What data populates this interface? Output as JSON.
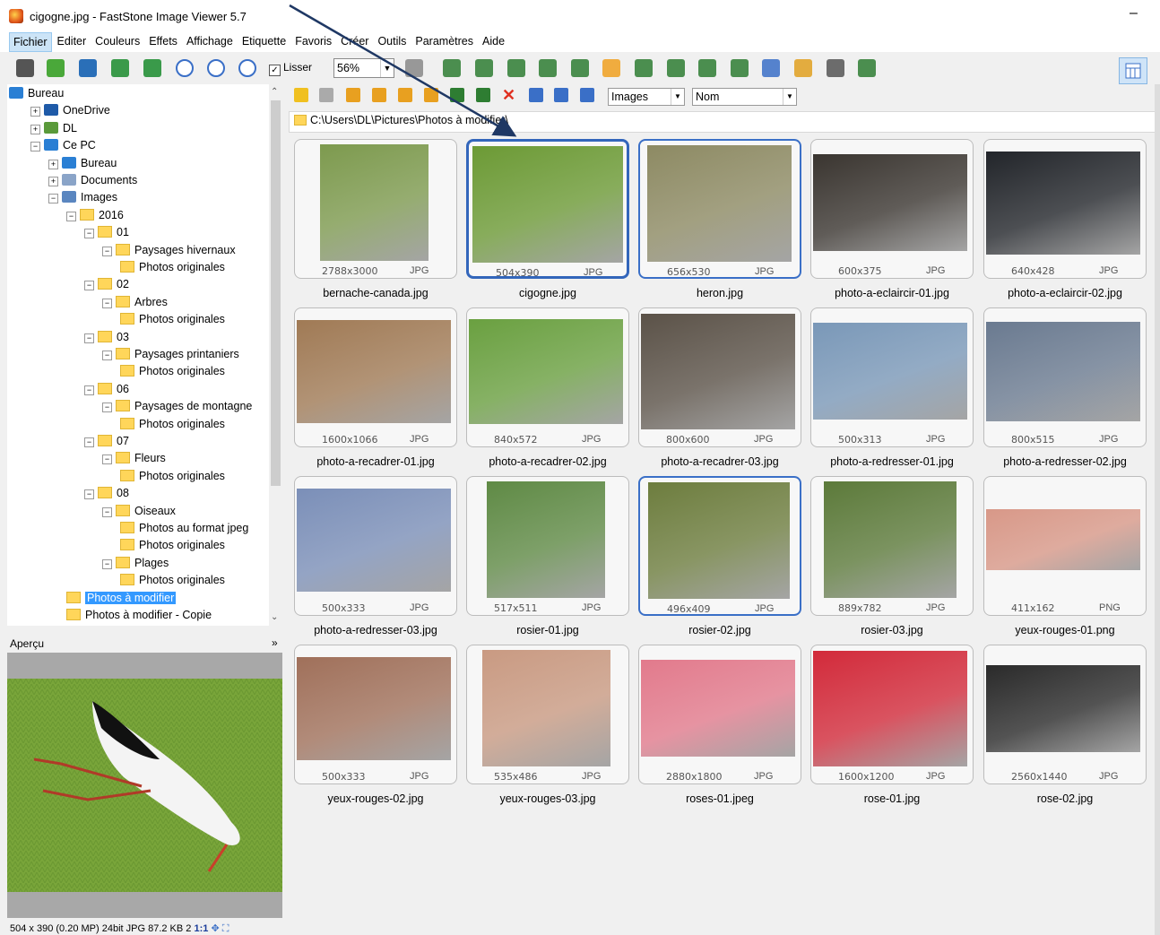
{
  "window": {
    "title": "cigogne.jpg  -  FastStone Image Viewer 5.7",
    "minimize": "–"
  },
  "menu": [
    "Fichier",
    "Editer",
    "Couleurs",
    "Effets",
    "Affichage",
    "Etiquette",
    "Favoris",
    "Créer",
    "Outils",
    "Paramètres",
    "Aide"
  ],
  "toolbar": {
    "smooth_label": "Lisser",
    "smooth_checked": "✓",
    "zoom": "56%"
  },
  "nav": {
    "filter": "Images",
    "sort": "Nom",
    "path": "C:\\Users\\DL\\Pictures\\Photos à modifier\\"
  },
  "tree": [
    {
      "label": "Bureau",
      "icon": "desktop-icon"
    },
    {
      "label": "OneDrive",
      "icon": "cloud-icon",
      "pm": "+"
    },
    {
      "label": "DL",
      "icon": "user-icon",
      "pm": "+"
    },
    {
      "label": "Ce PC",
      "icon": "computer-icon",
      "pm": "−"
    },
    {
      "label": "Bureau",
      "icon": "desktop-icon",
      "pm": "+"
    },
    {
      "label": "Documents",
      "icon": "document-icon",
      "pm": "+"
    },
    {
      "label": "Images",
      "icon": "pictures-icon",
      "pm": "−"
    },
    {
      "label": "2016",
      "icon": "folder-icon",
      "pm": "−"
    },
    {
      "label": "01",
      "icon": "folder-icon",
      "pm": "−"
    },
    {
      "label": "Paysages hivernaux",
      "icon": "folder-icon",
      "pm": "−"
    },
    {
      "label": "Photos originales",
      "icon": "folder-icon"
    },
    {
      "label": "02",
      "icon": "folder-icon",
      "pm": "−"
    },
    {
      "label": "Arbres",
      "icon": "folder-icon",
      "pm": "−"
    },
    {
      "label": "Photos originales",
      "icon": "folder-icon"
    },
    {
      "label": "03",
      "icon": "folder-icon",
      "pm": "−"
    },
    {
      "label": "Paysages printaniers",
      "icon": "folder-icon",
      "pm": "−"
    },
    {
      "label": "Photos originales",
      "icon": "folder-icon"
    },
    {
      "label": "06",
      "icon": "folder-icon",
      "pm": "−"
    },
    {
      "label": "Paysages de montagne",
      "icon": "folder-icon",
      "pm": "−"
    },
    {
      "label": "Photos originales",
      "icon": "folder-icon"
    },
    {
      "label": "07",
      "icon": "folder-icon",
      "pm": "−"
    },
    {
      "label": "Fleurs",
      "icon": "folder-icon",
      "pm": "−"
    },
    {
      "label": "Photos originales",
      "icon": "folder-icon"
    },
    {
      "label": "08",
      "icon": "folder-icon",
      "pm": "−"
    },
    {
      "label": "Oiseaux",
      "icon": "folder-icon",
      "pm": "−"
    },
    {
      "label": "Photos au format jpeg",
      "icon": "folder-icon"
    },
    {
      "label": "Photos originales",
      "icon": "folder-icon"
    },
    {
      "label": "Plages",
      "icon": "folder-icon",
      "pm": "−"
    },
    {
      "label": "Photos originales",
      "icon": "folder-icon"
    },
    {
      "label": "Photos à modifier",
      "icon": "folder-icon",
      "selected": true
    },
    {
      "label": "Photos à modifier - Copie",
      "icon": "folder-icon"
    }
  ],
  "preview": {
    "label": "Aperçu",
    "toggle": "»",
    "status": "504 x 390 (0.20 MP)  24bit  JPG  87.2 KB  2",
    "ratio": "1:1"
  },
  "thumbnails": [
    {
      "name": "bernache-canada.jpg",
      "dims": "2788x3000",
      "ext": "JPG",
      "color": "#7d9a4e"
    },
    {
      "name": "cigogne.jpg",
      "dims": "504x390",
      "ext": "JPG",
      "color": "#6c9a35",
      "selected": true
    },
    {
      "name": "heron.jpg",
      "dims": "656x530",
      "ext": "JPG",
      "color": "#8d8a63",
      "hover": true
    },
    {
      "name": "photo-a-eclaircir-01.jpg",
      "dims": "600x375",
      "ext": "JPG",
      "color": "#3a3530"
    },
    {
      "name": "photo-a-eclaircir-02.jpg",
      "dims": "640x428",
      "ext": "JPG",
      "color": "#22252a"
    },
    {
      "name": "photo-a-recadrer-01.jpg",
      "dims": "1600x1066",
      "ext": "JPG",
      "color": "#a07a55"
    },
    {
      "name": "photo-a-recadrer-02.jpg",
      "dims": "840x572",
      "ext": "JPG",
      "color": "#6aa040"
    },
    {
      "name": "photo-a-recadrer-03.jpg",
      "dims": "800x600",
      "ext": "JPG",
      "color": "#5b5248"
    },
    {
      "name": "photo-a-redresser-01.jpg",
      "dims": "500x313",
      "ext": "JPG",
      "color": "#7a98b8"
    },
    {
      "name": "photo-a-redresser-02.jpg",
      "dims": "800x515",
      "ext": "JPG",
      "color": "#6a7a90"
    },
    {
      "name": "photo-a-redresser-03.jpg",
      "dims": "500x333",
      "ext": "JPG",
      "color": "#7b8fb8"
    },
    {
      "name": "rosier-01.jpg",
      "dims": "517x511",
      "ext": "JPG",
      "color": "#5f8a45"
    },
    {
      "name": "rosier-02.jpg",
      "dims": "496x409",
      "ext": "JPG",
      "color": "#6d7d3e",
      "hover": true
    },
    {
      "name": "rosier-03.jpg",
      "dims": "889x782",
      "ext": "JPG",
      "color": "#5c7a3a"
    },
    {
      "name": "yeux-rouges-01.png",
      "dims": "411x162",
      "ext": "PNG",
      "color": "#d89888"
    },
    {
      "name": "yeux-rouges-02.jpg",
      "dims": "500x333",
      "ext": "JPG",
      "color": "#a0705a"
    },
    {
      "name": "yeux-rouges-03.jpg",
      "dims": "535x486",
      "ext": "JPG",
      "color": "#c99a82"
    },
    {
      "name": "roses-01.jpeg",
      "dims": "2880x1800",
      "ext": "JPG",
      "color": "#e27a8c"
    },
    {
      "name": "rose-01.jpg",
      "dims": "1600x1200",
      "ext": "JPG",
      "color": "#d22a3a"
    },
    {
      "name": "rose-02.jpg",
      "dims": "2560x1440",
      "ext": "JPG",
      "color": "#2a2a2a"
    }
  ]
}
